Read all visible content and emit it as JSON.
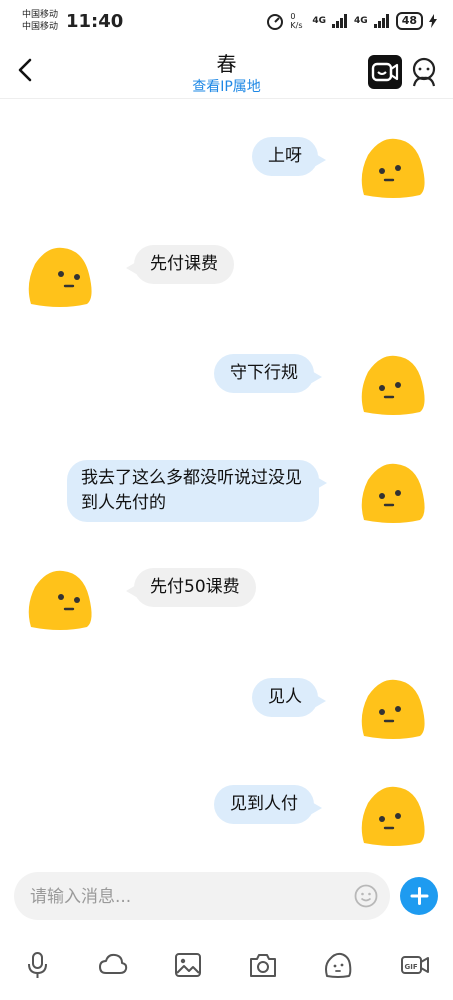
{
  "status_bar": {
    "carrier1": "中国移动",
    "carrier2": "中国移动",
    "time": "11:40",
    "net_speed": "0 K/s",
    "net1": "4G",
    "net2": "4G",
    "battery": "48"
  },
  "header": {
    "title": "春",
    "subtitle": "查看IP属地"
  },
  "messages": [
    {
      "side": "out",
      "text": "上呀"
    },
    {
      "side": "in",
      "text": "先付课费"
    },
    {
      "side": "out",
      "text": "守下行规"
    },
    {
      "side": "out",
      "text": "我去了这么多都没听说过没见到人先付的"
    },
    {
      "side": "in",
      "text": "先付50课费"
    },
    {
      "side": "out",
      "text": "见人"
    },
    {
      "side": "out",
      "text": "见到人付"
    }
  ],
  "input": {
    "placeholder": "请输入消息..."
  },
  "toolbar": [
    "mic-icon",
    "cloud-icon",
    "image-icon",
    "camera-icon",
    "sticker-icon",
    "gif-icon"
  ],
  "colors": {
    "accent": "#1e9bf0",
    "outgoing_bubble": "#dcecfb",
    "incoming_bubble": "#f0f0f0",
    "avatar": "#ffc21a"
  }
}
